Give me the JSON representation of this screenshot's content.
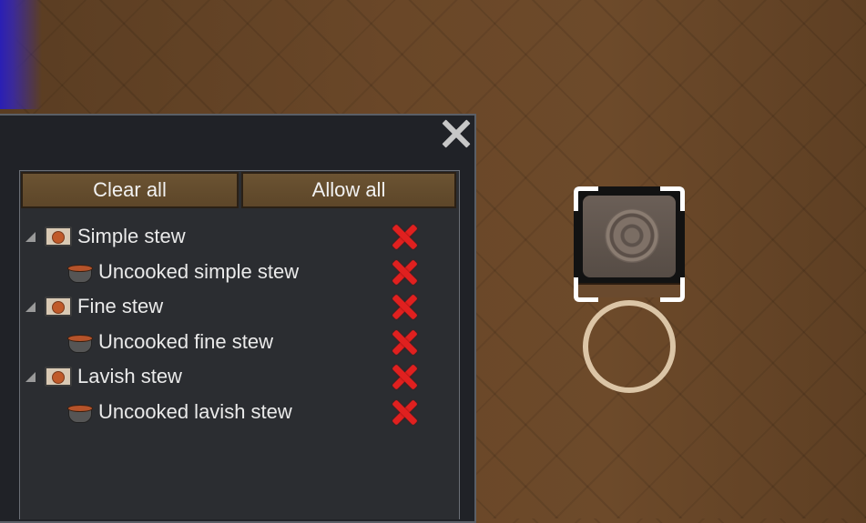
{
  "window": {
    "close_icon": "close-icon"
  },
  "toolbar": {
    "clear_label": "Clear all",
    "allow_label": "Allow all"
  },
  "tree": [
    {
      "label": "Simple stew",
      "kind": "category",
      "icon": "simple-stew-icon",
      "allowed": false
    },
    {
      "label": "Uncooked simple stew",
      "kind": "item",
      "icon": "pot-icon",
      "allowed": false
    },
    {
      "label": "Fine stew",
      "kind": "category",
      "icon": "fine-stew-icon",
      "allowed": false
    },
    {
      "label": "Uncooked fine stew",
      "kind": "item",
      "icon": "pot-icon",
      "allowed": false
    },
    {
      "label": "Lavish stew",
      "kind": "category",
      "icon": "lavish-stew-icon",
      "allowed": false
    },
    {
      "label": "Uncooked lavish stew",
      "kind": "item",
      "icon": "pot-icon",
      "allowed": false
    }
  ],
  "colors": {
    "disallowed_mark": "#e0201f",
    "button": "#6b5332",
    "panel": "#202227"
  }
}
